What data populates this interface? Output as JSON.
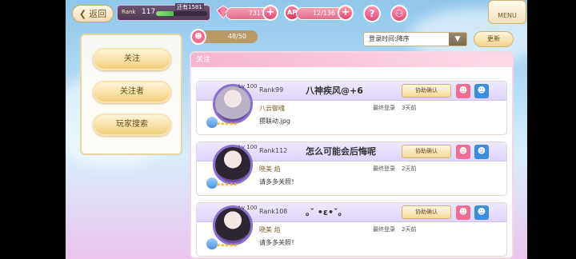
{
  "topbar": {
    "back_label": "返回",
    "rank_label": "Rank",
    "rank_value": "117",
    "rank_remaining": "还有1581",
    "rank_progress": 0.35,
    "gems": "7317",
    "ap_label": "AP",
    "ap": "12/136",
    "menu_label": "MENU"
  },
  "sidebar": {
    "items": [
      {
        "label": "关注"
      },
      {
        "label": "关注者"
      },
      {
        "label": "玩家搜索"
      }
    ]
  },
  "list": {
    "count": "48/50",
    "sort_value": "登录时间:降序",
    "refresh_label": "更新",
    "header": "关注",
    "cards": [
      {
        "level": "Lv 100",
        "rank": "Rank99",
        "name": "八神疾风@+6",
        "guild": "八云御魂",
        "message": "攒联动.jpg",
        "last_login_label": "最终登录",
        "last_login": "3天前",
        "assist_label": "协助确认"
      },
      {
        "level": "Lv 100",
        "rank": "Rank112",
        "name": "怎么可能会后悔呢",
        "guild": "晓美 焰",
        "message": "请多多关照！",
        "last_login_label": "最终登录",
        "last_login": "2天前",
        "assist_label": "协助确认"
      },
      {
        "level": "Lv 100",
        "rank": "Rank108",
        "name": "｡ˇ •ε•ˇ｡",
        "guild": "晓美 焰",
        "message": "请多多关照！",
        "last_login_label": "最终登录",
        "last_login": "2天前",
        "assist_label": "协助确认"
      }
    ]
  }
}
